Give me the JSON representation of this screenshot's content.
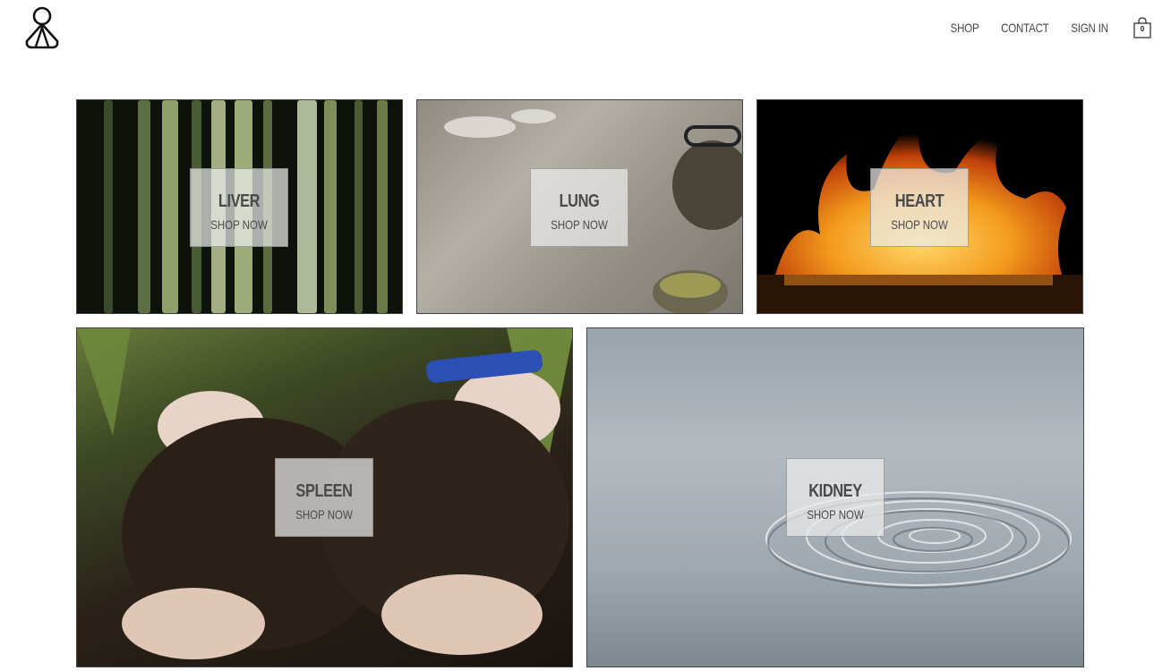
{
  "header": {
    "logo_icon": "person-logo-icon",
    "nav": [
      "SHOP",
      "CONTACT",
      "SIGN IN"
    ],
    "cart_count": "0",
    "cart_icon": "shopping-bag-icon"
  },
  "tiles": [
    {
      "title": "LIVER",
      "cta": "SHOP NOW"
    },
    {
      "title": "LUNG",
      "cta": "SHOP NOW"
    },
    {
      "title": "HEART",
      "cta": "SHOP NOW"
    },
    {
      "title": "SPLEEN",
      "cta": "SHOP NOW"
    },
    {
      "title": "KIDNEY",
      "cta": "SHOP NOW"
    }
  ]
}
